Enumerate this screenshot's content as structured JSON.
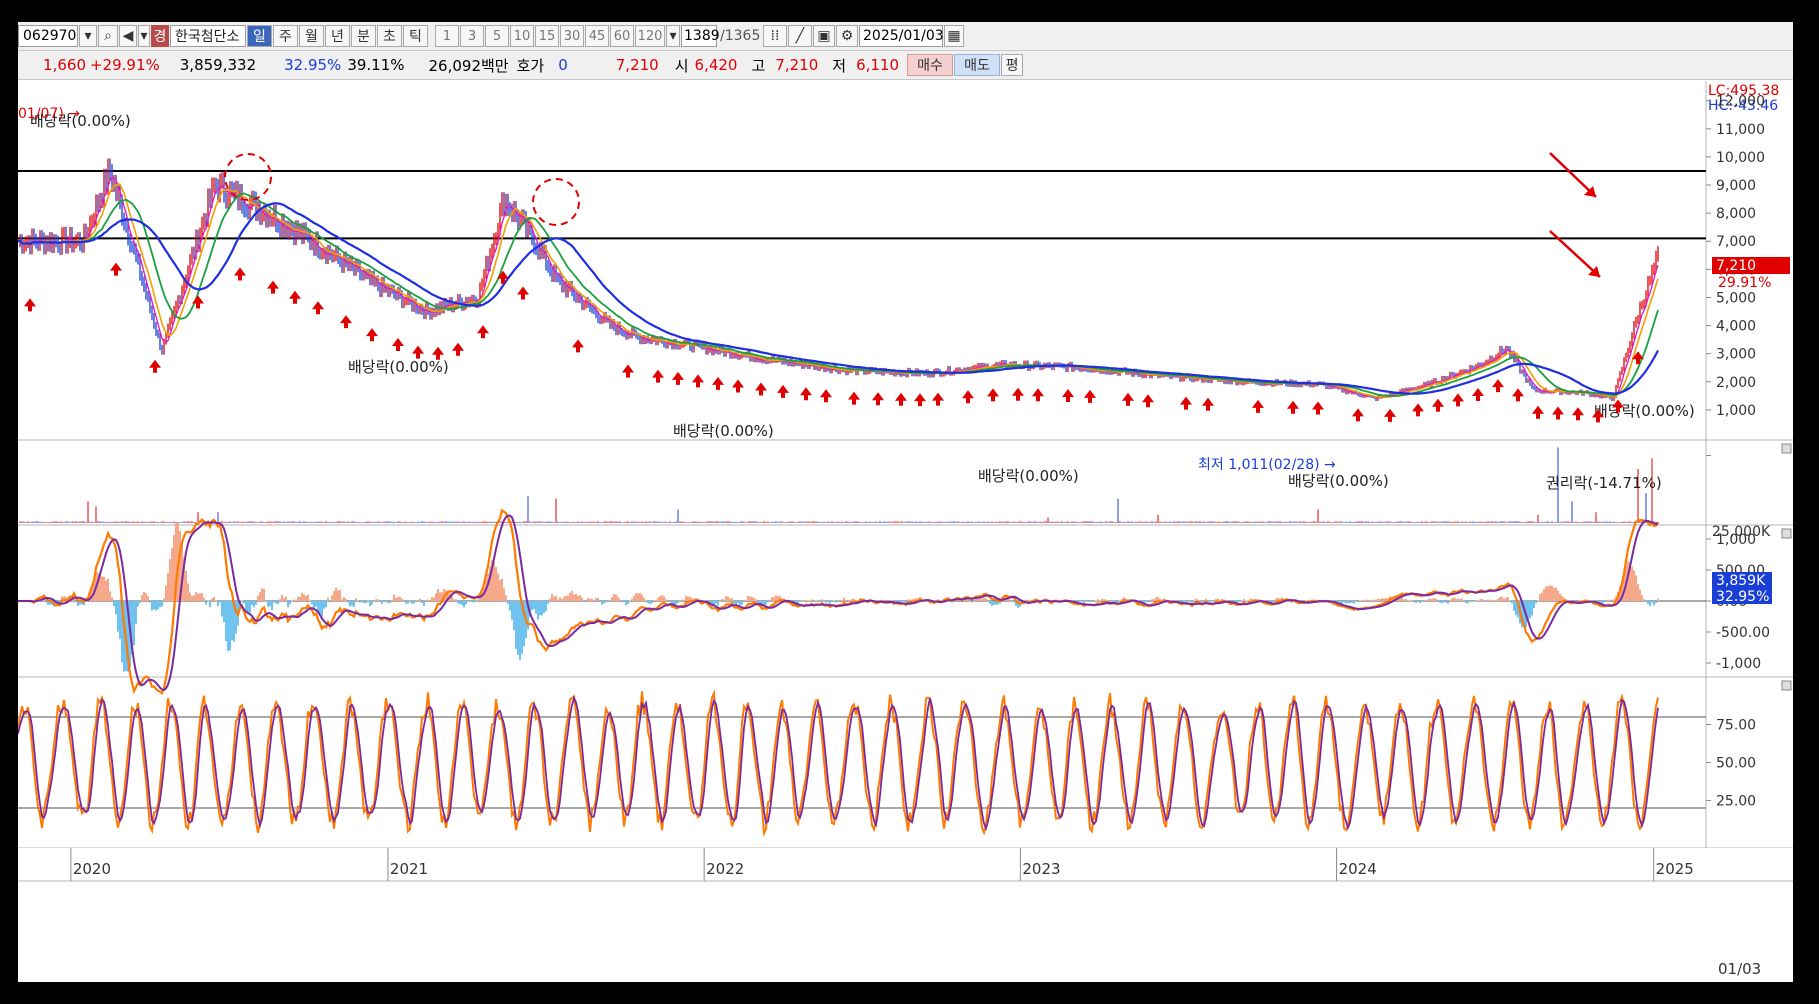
{
  "toolbar": {
    "code": "062970",
    "market_badge": "경",
    "name": "한국첨단소",
    "timeframes": [
      "일",
      "주",
      "월",
      "년",
      "분",
      "초",
      "틱"
    ],
    "active_timeframe": "일",
    "periods": [
      "1",
      "3",
      "5",
      "10",
      "15",
      "30",
      "45",
      "60",
      "120"
    ],
    "count": "1389",
    "total": "/1365",
    "date": "2025/01/03"
  },
  "quote": {
    "change": "1,660",
    "change_pct": "+29.91%",
    "volume": "3,859,332",
    "vol_ratio": "32.95%",
    "turnover": "39.11%",
    "amount": "26,092백만",
    "hoga_label": "호가",
    "hoga_value": "0",
    "price": "7,210",
    "open_label": "시",
    "open": "6,420",
    "high_label": "고",
    "high": "7,210",
    "low_label": "저",
    "low": "6,110",
    "buy_label": "매수",
    "sell_label": "매도",
    "avg_label": "평"
  },
  "price_panel": {
    "lc": "LC:495.38",
    "hc": "HC:-43.46",
    "y_ticks": [
      "12,000",
      "11,000",
      "10,000",
      "9,000",
      "8,000",
      "7,000",
      "6,000",
      "5,000",
      "4,000",
      "3,000",
      "2,000",
      "1,000"
    ],
    "last_price": "7,210",
    "last_pct": "29.91%",
    "annotations": [
      "01/07) →",
      "배당락(0.00%)",
      "배당락(0.00%)",
      "배당락(0.00%)",
      "배당락(0.00%)",
      "배당락(0.00%)",
      "권리락(-14.71%)",
      "배당락(0.00%)"
    ],
    "low_marker": "최저 1,011(02/28) →"
  },
  "volume_panel": {
    "y_tick": "25,000K",
    "last_volume": "3,859K",
    "last_pct": "32.95%"
  },
  "macd_panel": {
    "y_ticks": [
      "1,000",
      "500.00",
      "0.00",
      "-500.00",
      "-1,000"
    ]
  },
  "stoch_panel": {
    "y_ticks": [
      "75.00",
      "50.00",
      "25.00"
    ]
  },
  "x_axis": {
    "labels": [
      "2020",
      "2021",
      "2022",
      "2023",
      "2024",
      "2025"
    ],
    "right_label": "01/03"
  },
  "chart_data": {
    "type": "line",
    "x": [
      "2020-01",
      "2020-02",
      "2020-03",
      "2020-04",
      "2020-05",
      "2020-06",
      "2020-08",
      "2020-10",
      "2020-12",
      "2021-02",
      "2021-04",
      "2021-05",
      "2021-06",
      "2021-07",
      "2021-09",
      "2021-10",
      "2021-12",
      "2022-03",
      "2022-06",
      "2022-09",
      "2022-12",
      "2023-03",
      "2023-06",
      "2023-09",
      "2023-12",
      "2024-02",
      "2024-04",
      "2024-06",
      "2024-07",
      "2024-08",
      "2024-10",
      "2024-11",
      "2024-12",
      "2025-01"
    ],
    "series": [
      {
        "values": [
          7000,
          9500,
          6500,
          3100,
          6000,
          9000,
          8000,
          6800,
          5500,
          4500,
          5000,
          8500,
          7200,
          5600,
          4000,
          3600,
          3300,
          2800,
          2400,
          2300,
          2600,
          2500,
          2200,
          2000,
          1900,
          1400,
          1900,
          2600,
          3200,
          1700,
          1600,
          1400,
          4500,
          7210
        ]
      }
    ],
    "ylim": [
      0,
      12700
    ],
    "horizontal_lines": [
      9500,
      7100
    ],
    "volume_ylim": [
      0,
      30000
    ]
  },
  "colors": {
    "up": "#e00000",
    "down": "#1a3fd6",
    "ma_long": "#1f2fe0",
    "ma_mid": "#1aa03c",
    "ma_short": "#f0a000",
    "macd": "#ff7a00",
    "signal": "#7a2aa0"
  }
}
